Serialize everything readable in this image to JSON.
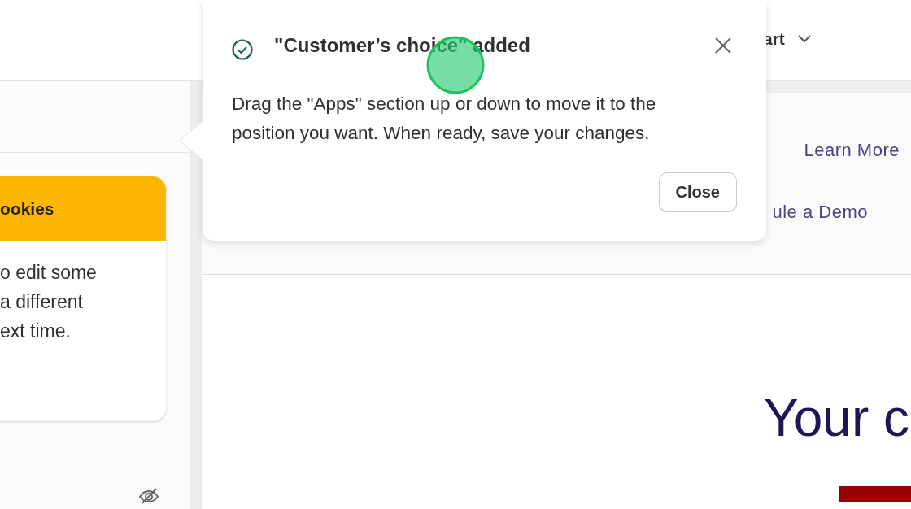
{
  "top_bar": {
    "menu_label": "art"
  },
  "sidebar": {
    "card": {
      "title": "ookies",
      "lines": [
        "o edit some",
        "a different",
        "ext time."
      ]
    }
  },
  "preview": {
    "nav_rows": [
      [
        "Learn More"
      ],
      [
        "ule a Demo"
      ]
    ],
    "hero_title": "Your c"
  },
  "popover": {
    "title": "\"Customer’s choice\" added",
    "message": "Drag the \"Apps\" section up or down to move it to the position you want. When ready, save your changes.",
    "button": "Close"
  }
}
